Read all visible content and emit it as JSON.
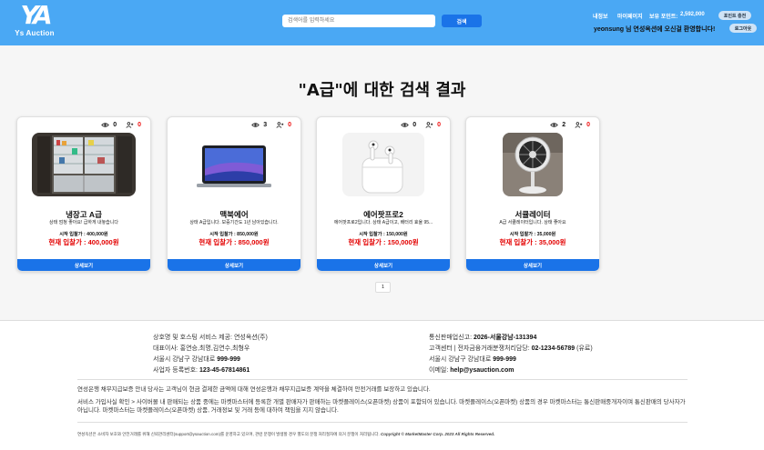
{
  "header": {
    "logo_mark": "YA",
    "logo_text": "Ys Auction",
    "search_placeholder": "검색어를 입력하세요",
    "search_button": "검색",
    "nav_myinfo": "내정보",
    "nav_mypage": "마이페이지",
    "points_label": "보유 포인트:",
    "points_value": "2,592,000",
    "charge_button": "포인트 충전",
    "welcome": "yeonsung 님 연성옥션에 오신걸 환영합니다!",
    "logout_button": "로그아웃"
  },
  "page": {
    "title": "\"A급\"에 대한 검색 결과"
  },
  "results": [
    {
      "views": "0",
      "bids": "0",
      "title": "냉장고 A급",
      "desc": "상태 엄청 좋아요! 급하게 내놓습니다",
      "start": "시작 입찰가 : 400,000원",
      "current": "현재 입찰가 : 400,000원",
      "detail": "상세보기"
    },
    {
      "views": "3",
      "bids": "0",
      "title": "맥북에어",
      "desc": "상태 A급입니다. 보증기간도 1년 남아있습니다.",
      "start": "시작 입찰가 : 850,000원",
      "current": "현재 입찰가 : 850,000원",
      "detail": "상세보기"
    },
    {
      "views": "0",
      "bids": "0",
      "title": "에어팟프로2",
      "desc": "에어팟프로2입니다. 상태 A급이고, 배터리 효율 95...",
      "start": "시작 입찰가 : 150,000원",
      "current": "현재 입찰가 : 150,000원",
      "detail": "상세보기"
    },
    {
      "views": "2",
      "bids": "0",
      "title": "서큘레이터",
      "desc": "A급 서큘레이터입니다. 상태 좋아요",
      "start": "시작 입찰가 : 35,000원",
      "current": "현재 입찰가 : 35,000원",
      "detail": "상세보기"
    }
  ],
  "pagination": {
    "current": "1"
  },
  "footer": {
    "hosting_label": "상호명 및 호스팅 서비스 제공:",
    "hosting_value": "연성옥션(주)",
    "reps_label": "대표이사:",
    "reps_value": "홍연승,최명,김연수,최형우",
    "address_left": "서울시 강남구 강남대로",
    "address_left_num": "999-999",
    "bizno_label": "사업자 등록번호:",
    "bizno_value": "123-45-67814861",
    "telecom_label": "통신판매업신고:",
    "telecom_value": "2026-서울강남-131394",
    "center_label": "고객센터 | 전자금융거래분쟁처리담당:",
    "center_value": "02-1234-56789",
    "center_suffix": "(유료)",
    "address_right": "서울시 강남구 강남대로",
    "address_right_num": "999-999",
    "email_label": "이메일:",
    "email_value": "help@ysauction.com",
    "notice1": "연성은행 채무지급보증 안내 당사는 고객님이 현금 결제한 금액에 대해 연성은행과 채무지급보증 계약을 체결하여 안전거래를 보장하고 있습니다.",
    "notice2": "서비스 가입사실 확인 > 사이버몰 내 판매되는 상품 중에는 마켓마스터에 등록한 개별 판매자가 판매하는 마켓플레이스(오픈마켓) 상품이 포함되어 있습니다. 마켓플레이스(오픈마켓) 상품의 경우 마켓마스터는 통신판매중개자이며 통신판매의 당사자가 아닙니다. 마켓마스터는 마켓플레이스(오픈마켓) 상품, 거래정보 및 거래 등에 대하여 책임을 지지 않습니다.",
    "bottom_text": "연성옥션은 소비자 보호와 안전거래를 위해 신뢰관리센터(support@ysauction.com)를 운영하고 있으며, 관련 분쟁이 발생할 경우 별도의 분쟁 처리절차에 의거 분쟁이 처리됩니다.",
    "copyright": "Copyright © MarketMaster Corp. 2023 All Rights Reserved."
  },
  "colors": {
    "header_bg": "#4aa8f4",
    "primary_button": "#1a73e8",
    "price_red": "#e30000"
  },
  "icons": [
    "eye-icon",
    "bidder-icon"
  ]
}
